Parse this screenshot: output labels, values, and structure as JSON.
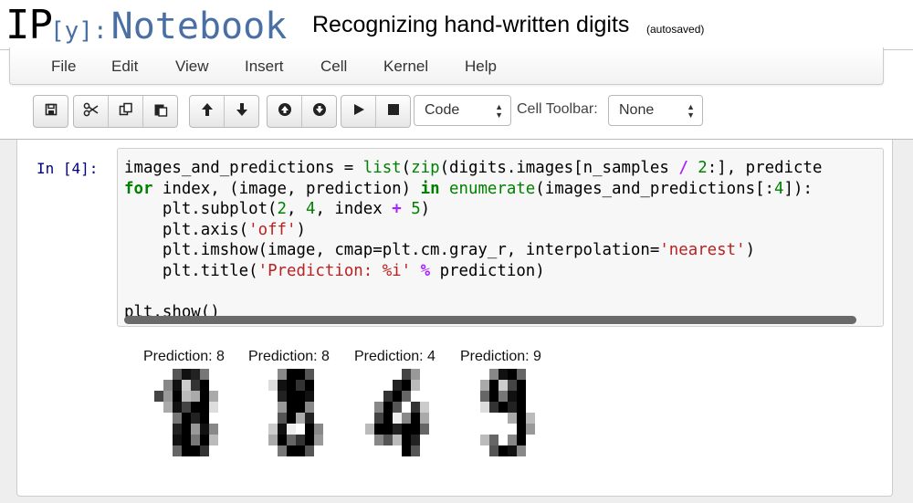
{
  "header": {
    "logo_ip": "IP",
    "logo_y": "[y]:",
    "logo_notebook": "Notebook",
    "notebook_title": "Recognizing hand-written digits",
    "save_status": "(autosaved)"
  },
  "menu": {
    "items": [
      "File",
      "Edit",
      "View",
      "Insert",
      "Cell",
      "Kernel",
      "Help"
    ]
  },
  "toolbar": {
    "cell_type": "Code",
    "cell_toolbar_label": "Cell Toolbar:",
    "cell_toolbar_value": "None"
  },
  "cell": {
    "prompt": "In [4]:",
    "code_lines": [
      "images_and_predictions = list(zip(digits.images[n_samples / 2:], predicte",
      "for index, (image, prediction) in enumerate(images_and_predictions[:4]):",
      "    plt.subplot(2, 4, index + 5)",
      "    plt.axis('off')",
      "    plt.imshow(image, cmap=plt.cm.gray_r, interpolation='nearest')",
      "    plt.title('Prediction: %i' % prediction)",
      "",
      "plt.show()"
    ]
  },
  "output": {
    "titles": [
      "Prediction: 8",
      "Prediction: 8",
      "Prediction: 4",
      "Prediction: 9"
    ]
  },
  "icons": [
    "save-icon",
    "cut-icon",
    "copy-icon",
    "paste-icon",
    "move-up-icon",
    "move-down-icon",
    "insert-above-icon",
    "insert-below-icon",
    "run-icon",
    "stop-icon"
  ]
}
